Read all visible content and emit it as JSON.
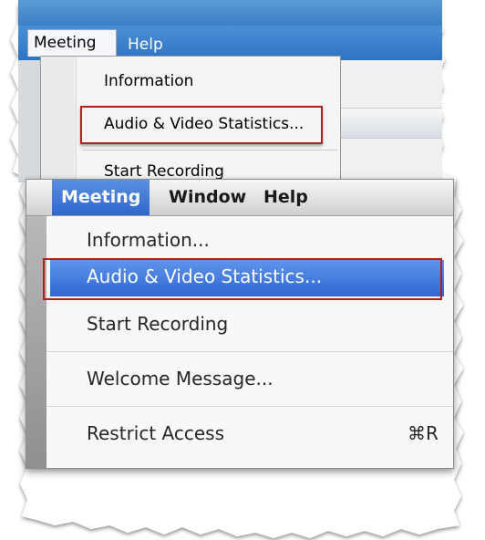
{
  "background_window": {
    "menubar": {
      "meeting_label": "Meeting",
      "help_label": "Help"
    },
    "meeting_menu": {
      "items": [
        {
          "label": "Information"
        },
        {
          "label": "Audio & Video Statistics..."
        },
        {
          "label": "Start Recording"
        }
      ],
      "highlighted_item": "Audio & Video Statistics..."
    }
  },
  "foreground_window": {
    "menubar": {
      "meeting_label": "Meeting",
      "window_label": "Window",
      "help_label": "Help"
    },
    "meeting_menu": {
      "items": [
        {
          "label": "Information..."
        },
        {
          "label": "Audio & Video Statistics..."
        },
        {
          "label": "Start Recording"
        },
        {
          "label": "Welcome Message..."
        },
        {
          "label": "Restrict Access",
          "shortcut": "⌘R"
        }
      ],
      "selected_item": "Audio & Video Statistics..."
    }
  },
  "colors": {
    "highlight_border": "#b51c1c",
    "mac_selection": "#2e66d4",
    "windows_menubar": "#3d7fc4"
  }
}
